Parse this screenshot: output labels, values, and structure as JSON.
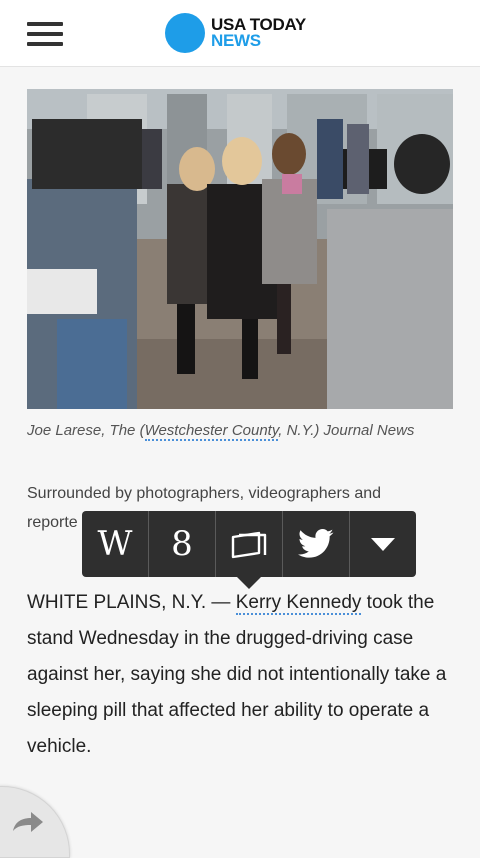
{
  "header": {
    "menu_icon": "hamburger-menu-icon",
    "brand_line1": "USA TODAY",
    "brand_line2": "NEWS",
    "brand_color": "#1e9de8"
  },
  "photo": {
    "alt": "Kerry Kennedy surrounded by photographers"
  },
  "credit": {
    "prefix": "Joe Larese, The (",
    "link": "Westchester County",
    "suffix": ", N.Y.) Journal News"
  },
  "caption": {
    "line1": "Surrounded by photographers, videographers and",
    "line2": "reporte"
  },
  "share_toolbar": {
    "wikipedia": "W",
    "google": "8",
    "reader_icon": "reader-icon",
    "twitter_icon": "twitter-icon",
    "more_icon": "dropdown-arrow-icon"
  },
  "article": {
    "lead": "WHITE PLAINS, N.Y. — ",
    "link": "Kerry Kennedy",
    "rest": " took the stand Wednesday in the drugged-driving case against her, saying she did not intentionally take a sleeping pill that affected her ability to operate a vehicle."
  },
  "corner_icon": "share-arrow-icon"
}
